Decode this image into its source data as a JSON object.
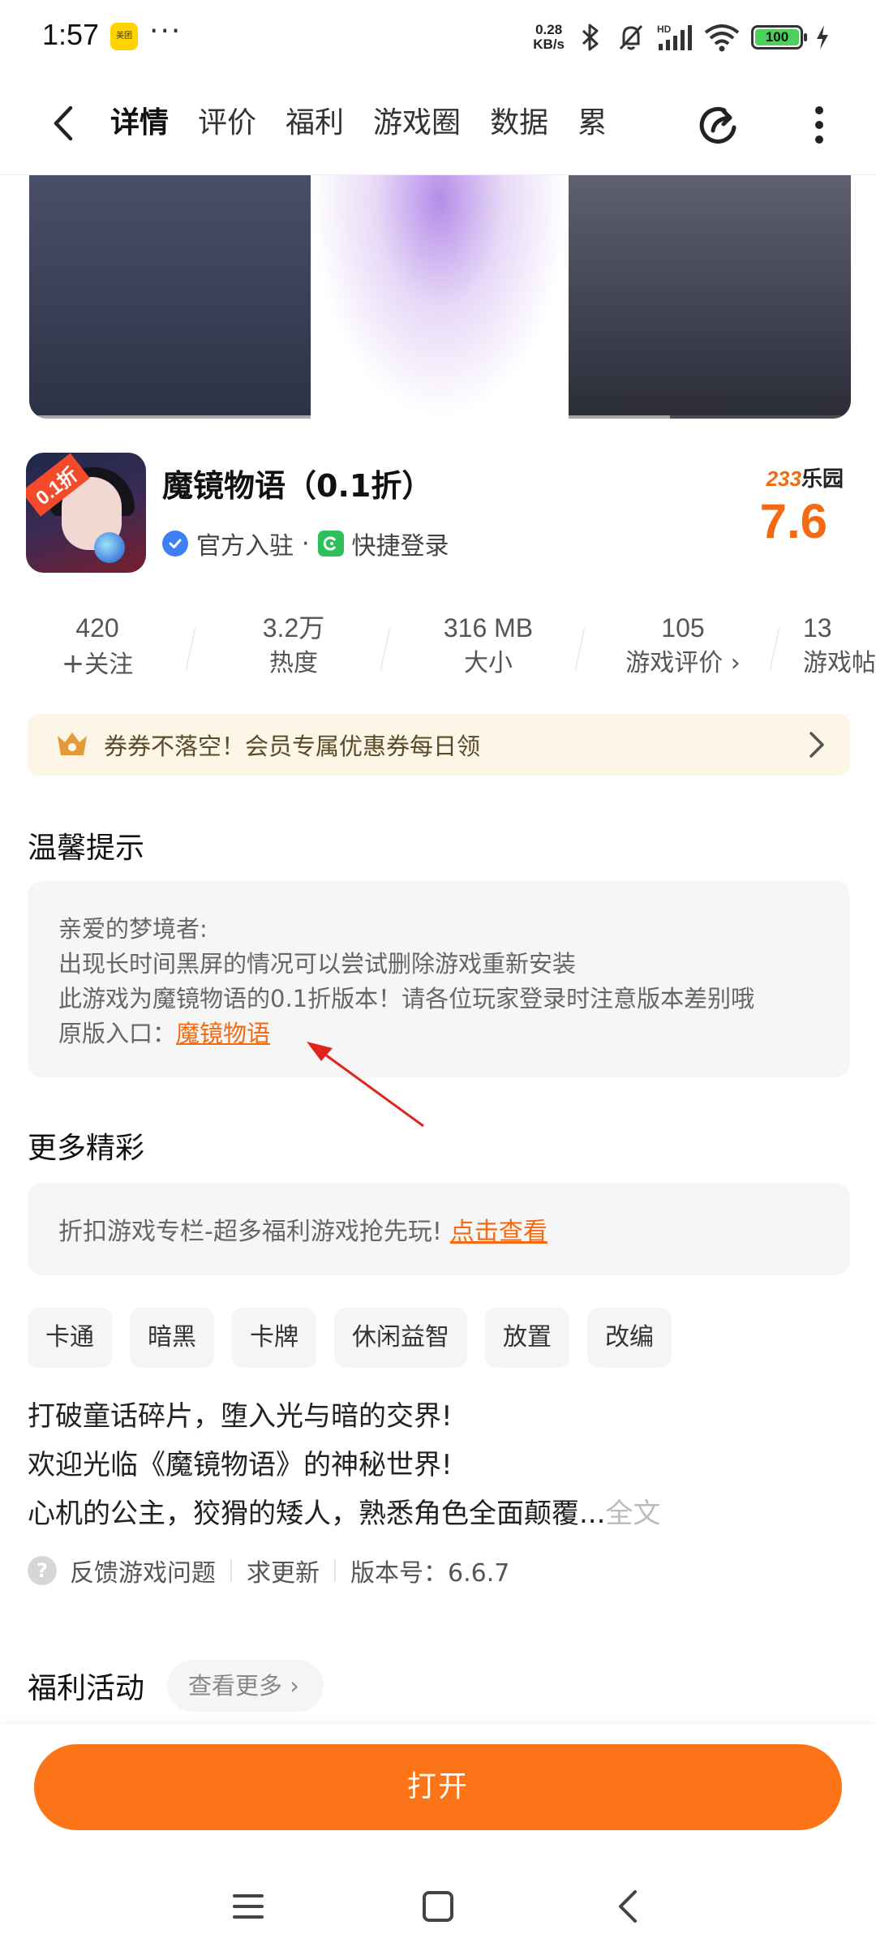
{
  "status_bar": {
    "time": "1:57",
    "app_badge": "美团",
    "more_dots": "···",
    "net_speed_value": "0.28",
    "net_speed_unit": "KB/s",
    "signal_label": "HD",
    "battery": "100",
    "icons": [
      "bluetooth-icon",
      "mute-bell-icon",
      "signal-icon",
      "wifi-icon",
      "battery-icon",
      "charging-icon"
    ]
  },
  "tabs": {
    "items": [
      {
        "label": "详情",
        "active": true
      },
      {
        "label": "评价"
      },
      {
        "label": "福利"
      },
      {
        "label": "游戏圈"
      },
      {
        "label": "数据"
      },
      {
        "label": "累"
      }
    ],
    "accent": "#ff7a14"
  },
  "game": {
    "icon_badge": "0.1折",
    "title": "魔镜物语（0.1折）",
    "official": "官方入驻",
    "dot": "·",
    "quick_login": "快捷登录",
    "rating_brand_num": "233",
    "rating_brand_text": "乐园",
    "rating": "7.6",
    "rating_color": "#f36a12"
  },
  "stats": [
    {
      "value": "420",
      "label": "关注",
      "prefix": "+"
    },
    {
      "value": "3.2万",
      "label": "热度"
    },
    {
      "value": "316 MB",
      "label": "大小"
    },
    {
      "value": "105",
      "label": "游戏评价",
      "suffix": "›"
    },
    {
      "value": "13",
      "label": "游戏帖"
    }
  ],
  "coupon": {
    "text": "券券不落空！会员专属优惠券每日领"
  },
  "tips": {
    "title": "温馨提示",
    "lines": [
      "亲爱的梦境者:",
      "出现长时间黑屏的情况可以尝试删除游戏重新安装",
      "此游戏为魔镜物语的0.1折版本！请各位玩家登录时注意版本差别哦"
    ],
    "original_prefix": "原版入口：",
    "original_link": "魔镜物语"
  },
  "more": {
    "title": "更多精彩",
    "text": "折扣游戏专栏-超多福利游戏抢先玩!",
    "link": "点击查看"
  },
  "tags": [
    "卡通",
    "暗黑",
    "卡牌",
    "休闲益智",
    "放置",
    "改编"
  ],
  "description": {
    "lines": [
      "打破童话碎片，堕入光与暗的交界!",
      "欢迎光临《魔镜物语》的神秘世界!",
      "心机的公主，狡猾的矮人，熟悉角色全面颠覆..."
    ],
    "full_text": "全文"
  },
  "feedback": {
    "report": "反馈游戏问题",
    "update": "求更新",
    "version": "版本号：6.6.7"
  },
  "welfare": {
    "title": "福利活动",
    "see_more": "查看更多 ›"
  },
  "action": {
    "open": "打开",
    "color": "#fb7417"
  }
}
